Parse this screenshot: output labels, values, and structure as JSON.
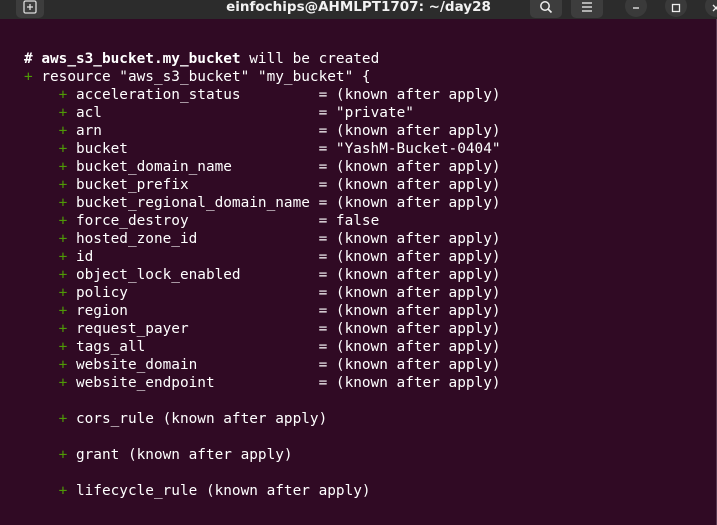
{
  "window": {
    "title": "einfochips@AHMLPT1707: ~/day28",
    "buttons": [
      "new-tab",
      "search",
      "menu",
      "minimize",
      "maximize",
      "close"
    ]
  },
  "colors": {
    "terminal_bg": "#300a24",
    "titlebar_bg": "#2c2c2c",
    "plus_green": "#4e9a06",
    "text": "#ffffff"
  },
  "terminal": {
    "header_name": "aws_s3_bucket.my_bucket",
    "header_rest": " will be created",
    "resource_line": " resource \"aws_s3_bucket\" \"my_bucket\" {",
    "attributes": [
      {
        "name": "acceleration_status",
        "value": "(known after apply)"
      },
      {
        "name": "acl",
        "value": "\"private\""
      },
      {
        "name": "arn",
        "value": "(known after apply)"
      },
      {
        "name": "bucket",
        "value": "\"YashM-Bucket-0404\""
      },
      {
        "name": "bucket_domain_name",
        "value": "(known after apply)"
      },
      {
        "name": "bucket_prefix",
        "value": "(known after apply)"
      },
      {
        "name": "bucket_regional_domain_name",
        "value": "(known after apply)"
      },
      {
        "name": "force_destroy",
        "value": "false"
      },
      {
        "name": "hosted_zone_id",
        "value": "(known after apply)"
      },
      {
        "name": "id",
        "value": "(known after apply)"
      },
      {
        "name": "object_lock_enabled",
        "value": "(known after apply)"
      },
      {
        "name": "policy",
        "value": "(known after apply)"
      },
      {
        "name": "region",
        "value": "(known after apply)"
      },
      {
        "name": "request_payer",
        "value": "(known after apply)"
      },
      {
        "name": "tags_all",
        "value": "(known after apply)"
      },
      {
        "name": "website_domain",
        "value": "(known after apply)"
      },
      {
        "name": "website_endpoint",
        "value": "(known after apply)"
      }
    ],
    "blocks": [
      "cors_rule (known after apply)",
      "grant (known after apply)",
      "lifecycle_rule (known after apply)"
    ]
  }
}
